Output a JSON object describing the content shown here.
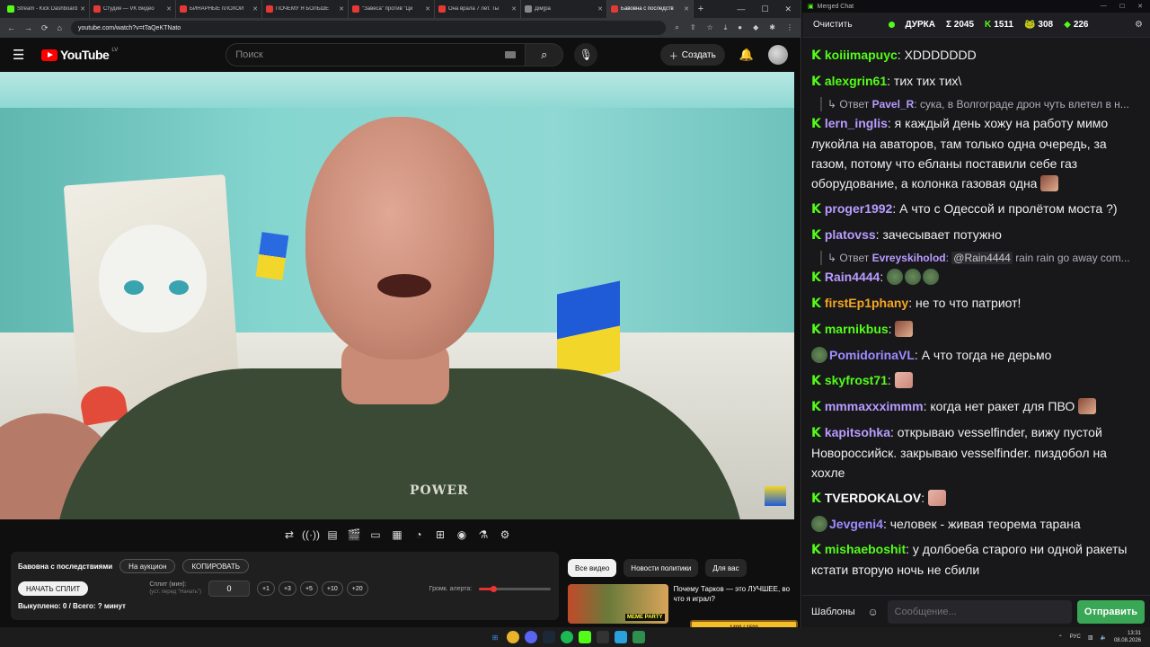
{
  "browser": {
    "tabs": [
      {
        "label": "Stream - Kick Dashboard",
        "color": "#53fc18",
        "active": false
      },
      {
        "label": "Студия — VK Видео",
        "color": "#e53935",
        "active": false
      },
      {
        "label": "БИНАРНЫЕ пЛОХОЙ",
        "color": "#e53935",
        "active": false
      },
      {
        "label": "ПОЧЕМУ Я БОЛЬШЕ",
        "color": "#e53935",
        "active": false
      },
      {
        "label": "\"Завеса\" против \"Ци",
        "color": "#e53935",
        "active": false
      },
      {
        "label": "Она врала 7 лет. Ты",
        "color": "#e53935",
        "active": false
      },
      {
        "label": "Дiм]ра",
        "color": "#888888",
        "active": false
      },
      {
        "label": "Бавовна с последств",
        "color": "#e53935",
        "active": true
      }
    ],
    "url": "youtube.com/watch?v=tTaQeKTNato"
  },
  "youtube": {
    "logo_text": "YouTube",
    "region": "LV",
    "search_placeholder": "Поиск",
    "create_label": "Создать",
    "video_shirt_text": "POWER"
  },
  "panel": {
    "title": "Бавовна с последствиями",
    "auction_label": "На аукцион",
    "copy_label": "КОПИРОВАТЬ",
    "start_label": "НАЧАТЬ СПЛИТ",
    "split_label": "Сплит (мин):",
    "split_hint": "(уст. перед \"Начать\")",
    "split_value": "0",
    "increments": [
      "+1",
      "+3",
      "+5",
      "+10",
      "+20"
    ],
    "volume_label": "Громк. алерта:",
    "volume_level": 0.2,
    "bought_text": "Выкуплено: 0 / Всего: ? минут"
  },
  "recommend": {
    "chips": [
      "Все видео",
      "Новости политики",
      "Для вас"
    ],
    "video_title": "Почему Тарков — это ЛУЧШЕЕ, во что я играл?",
    "thumb_badge": "MEME PARTY"
  },
  "chat": {
    "window_title": "Merged Chat",
    "clear_label": "Очистить",
    "stream_name": "ДУРКА",
    "stat_total": "Σ 2045",
    "stat_kick": "1511",
    "stat_b": "308",
    "stat_c": "226",
    "messages": [
      {
        "type": "msg",
        "user": "koiiimapuyc",
        "color": "#53fc18",
        "text": "XDDDDDDD",
        "platform": "kick"
      },
      {
        "type": "msg",
        "user": "alexgrin61",
        "color": "#53fc18",
        "text": "тих тих тих\\",
        "platform": "kick"
      },
      {
        "type": "reply",
        "prefix": "Ответ",
        "user": "Pavel_R",
        "text": "сука, в Волгограде дрон чуть влетел в н..."
      },
      {
        "type": "msg",
        "user": "lern_inglis",
        "color": "#b99cff",
        "text": "я каждый день хожу на работу мимо лукойла на аваторов, там только одна очередь, за газом, потому что ебланы поставили себе газ оборудование, а колонка газовая одна",
        "platform": "kick",
        "emote_after": true
      },
      {
        "type": "msg",
        "user": "proger1992",
        "color": "#b99cff",
        "text": "А  что с Одессой и пролётом моста ?)",
        "platform": "kick"
      },
      {
        "type": "msg",
        "user": "platovss",
        "color": "#b99cff",
        "text": "зачесывает потужно",
        "platform": "kick"
      },
      {
        "type": "reply",
        "prefix": "Ответ",
        "user": "Evreyskiholod",
        "mention": "@Rain4444",
        "text": "rain rain go away com..."
      },
      {
        "type": "msg",
        "user": "Rain4444",
        "color": "#b99cff",
        "text": "",
        "platform": "kick",
        "emotes": 3
      },
      {
        "type": "msg",
        "user": "firstEp1phany",
        "color": "#f5a623",
        "text": "не то что патриот!",
        "platform": "kick"
      },
      {
        "type": "msg",
        "user": "marnikbus",
        "color": "#53fc18",
        "text": "",
        "platform": "kick",
        "emote_after": true
      },
      {
        "type": "msg",
        "user": "PomidorinaVL",
        "color": "#9f8cff",
        "text": "А что тогда не дерьмо",
        "platform": "other"
      },
      {
        "type": "msg",
        "user": "skyfrost71",
        "color": "#53fc18",
        "text": "",
        "platform": "kick",
        "emote_after": true,
        "emote_pink": true
      },
      {
        "type": "msg",
        "user": "mmmaxxximmm",
        "color": "#b99cff",
        "text": "когда нет ракет для ПВО",
        "platform": "kick",
        "emote_after": true
      },
      {
        "type": "msg",
        "user": "kapitsohka",
        "color": "#b99cff",
        "text": "открываю vesselfinder, вижу пустой Новороссийск. закрываю vesselfinder. пиздобол на хохле",
        "platform": "kick"
      },
      {
        "type": "msg",
        "user": "TVERDOKALOV",
        "color": "#ffffff",
        "text": "",
        "platform": "kick",
        "emote_after": true,
        "emote_pink": true
      },
      {
        "type": "msg",
        "user": "Jevgeni4",
        "color": "#9f8cff",
        "text": "человек - живая теорема тарана",
        "platform": "other"
      },
      {
        "type": "msg",
        "user": "mishaeboshit",
        "color": "#53fc18",
        "text": "у долбоеба старого ни одной ракеты кстати вторую ночь не сбили",
        "platform": "kick"
      }
    ],
    "templates_label": "Шаблоны",
    "input_placeholder": "Сообщение...",
    "send_label": "Отправить"
  },
  "taskbar": {
    "lang": "РУС",
    "time": "13:31",
    "date": "08.08.2026"
  },
  "stream_widget": "1400 / 1500"
}
